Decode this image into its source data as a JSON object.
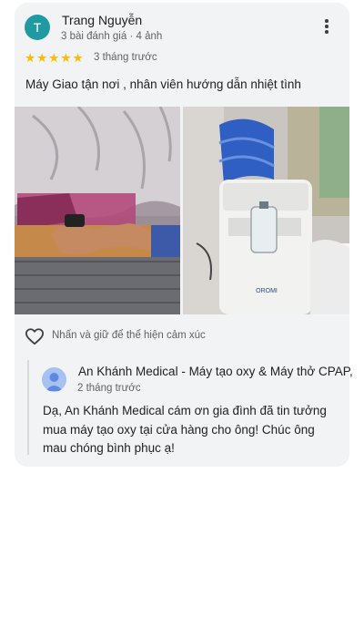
{
  "review": {
    "avatar_initial": "T",
    "reviewer_name": "Trang Nguyễn",
    "reviewer_meta": "3 bài đánh giá · 4 ảnh",
    "rating": 5,
    "stars": [
      "★",
      "★",
      "★",
      "★",
      "★"
    ],
    "time": "3 tháng trước",
    "text": "Máy Giao tận nơi , nhân viên hướng dẫn nhiệt tình",
    "photo_device_logo": "OROMI"
  },
  "reactions": {
    "label": "Nhấn và giữ để thể hiện cảm xúc"
  },
  "owner_reply": {
    "name": "An Khánh Medical - Máy tạo oxy & Máy thở CPAP,",
    "time": "2 tháng trước",
    "text": "Dạ, An Khánh Medical cám ơn gia đình đã tin tưởng mua máy tạo oxy tại cửa hàng cho ông! Chúc ông mau chóng bình phục ạ!"
  },
  "colors": {
    "avatar": "#1e9aa0",
    "star": "#fbbc04",
    "card_bg": "#f1f3f4",
    "owner_avatar": "#a7c1f2"
  }
}
